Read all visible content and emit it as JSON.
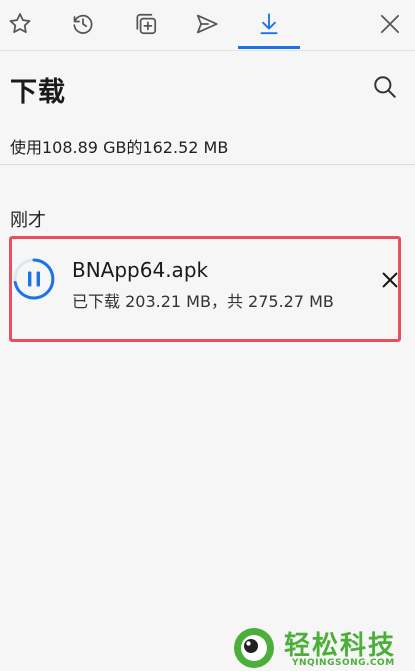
{
  "tabs": [
    {
      "icon": "star-icon"
    },
    {
      "icon": "history-icon"
    },
    {
      "icon": "add-collection-icon"
    },
    {
      "icon": "send-icon"
    },
    {
      "icon": "download-icon",
      "active": true
    }
  ],
  "header": {
    "title": "下载"
  },
  "storage": {
    "text": "使用108.89 GB的162.52 MB"
  },
  "section": {
    "label": "刚才"
  },
  "download": {
    "file_name": "BNApp64.apk",
    "progress_text": "已下载 203.21 MB，共 275.27 MB"
  },
  "watermark": {
    "title": "轻松科技",
    "subtitle": "YNQINGSONG.COM"
  },
  "colors": {
    "accent": "#1a73e8",
    "highlight_border": "#e8505b",
    "watermark_green": "#4caf3a"
  }
}
